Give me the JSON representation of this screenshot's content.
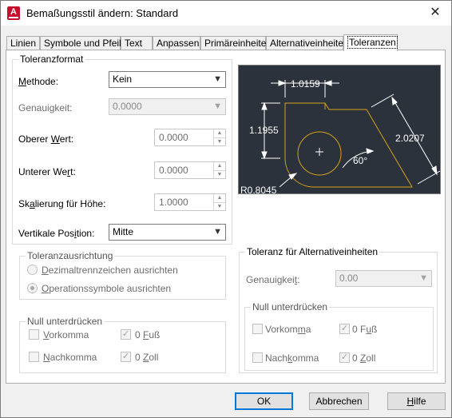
{
  "window": {
    "title": "Bemaßungsstil ändern: Standard",
    "app_icon_letter": "A",
    "close_glyph": "✕"
  },
  "tabs": [
    {
      "label": "Linien",
      "active": false
    },
    {
      "label": "Symbole und Pfeile",
      "active": false
    },
    {
      "label": "Text",
      "active": false
    },
    {
      "label": "Anpassen",
      "active": false
    },
    {
      "label": "Primäreinheiten",
      "active": false
    },
    {
      "label": "Alternativeinheiten",
      "active": false
    },
    {
      "label": "Toleranzen",
      "active": true
    }
  ],
  "toleranzformat": {
    "group_label": "Toleranzformat",
    "methode": {
      "label_pre": "",
      "label_u": "M",
      "label_post": "ethode:",
      "value": "Kein"
    },
    "genauigkeit": {
      "label_pre": "Genauigkeit:",
      "value": "0.0000"
    },
    "oberer_wert": {
      "label_pre": "Oberer ",
      "label_u": "W",
      "label_post": "ert:",
      "value": "0.0000"
    },
    "unterer_wert": {
      "label_pre": "Unterer We",
      "label_u": "r",
      "label_post": "t:",
      "value": "0.0000"
    },
    "skalierung": {
      "label_pre": "Sk",
      "label_u": "a",
      "label_post": "lierung für Höhe:",
      "value": "1.0000"
    },
    "vertikale_position": {
      "label_pre": "Vertikale Pos",
      "label_u": "i",
      "label_post": "tion:",
      "value": "Mitte"
    }
  },
  "toleranzausrichtung": {
    "group_label": "Toleranzausrichtung",
    "opt1": {
      "label_pre": "",
      "label_u": "D",
      "label_post": "ezimaltrennzeichen ausrichten",
      "selected": false
    },
    "opt2": {
      "label_pre": "",
      "label_u": "O",
      "label_post": "perationssymbole ausrichten",
      "selected": true
    }
  },
  "null_links": {
    "group_label": "Null unterdrücken",
    "vorkomma": {
      "label_pre": "",
      "label_u": "V",
      "label_post": "orkomma",
      "checked": false
    },
    "fuss": {
      "label_pre": "0 ",
      "label_u": "F",
      "label_post": "uß",
      "checked": true
    },
    "nachkomma": {
      "label_pre": "",
      "label_u": "N",
      "label_post": "achkomma",
      "checked": false
    },
    "zoll": {
      "label_pre": "0 ",
      "label_u": "Z",
      "label_post": "oll",
      "checked": true
    }
  },
  "alternativ": {
    "group_label": "Toleranz für Alternativeinheiten",
    "genauigkeit": {
      "label_pre": "Genauigkei",
      "label_u": "t",
      "label_post": ":",
      "value": "0.00"
    },
    "null_label": "Null unterdrücken",
    "vorkomma": {
      "label_pre": "Vorkom",
      "label_u": "m",
      "label_post": "a",
      "checked": false
    },
    "fuss": {
      "label_pre": "0 F",
      "label_u": "u",
      "label_post": "ß",
      "checked": true
    },
    "nachkomma": {
      "label_pre": "Nach",
      "label_u": "k",
      "label_post": "omma",
      "checked": false
    },
    "zoll": {
      "label_pre": "0 ",
      "label_u": "Z",
      "label_post": "oll",
      "checked": true
    }
  },
  "preview": {
    "dim_top": "1.0159",
    "dim_left": "1.1955",
    "dim_right": "2.0207",
    "angle": "60°",
    "radius": "R0.8045",
    "colors": {
      "bg": "#2c323c",
      "geometry": "#d4a017",
      "dims": "#ffffff"
    }
  },
  "buttons": {
    "ok": "OK",
    "cancel": "Abbrechen",
    "help_pre": "",
    "help_u": "H",
    "help_post": "ilfe"
  },
  "colors": {
    "accent": "#0078d7",
    "app_icon": "#c8102e"
  }
}
